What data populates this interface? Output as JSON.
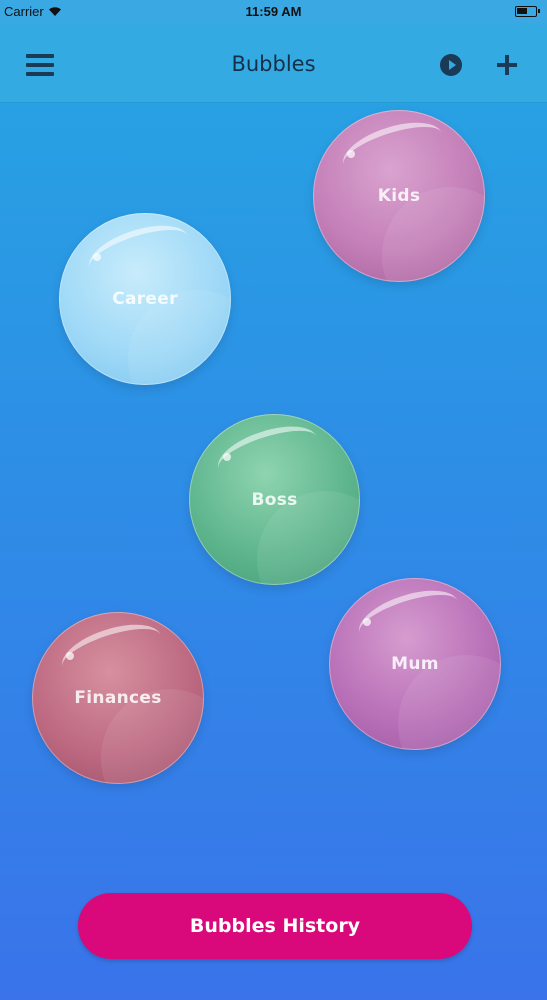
{
  "status_bar": {
    "carrier": "Carrier",
    "time": "11:59 AM",
    "wifi_icon": "wifi-icon",
    "battery_icon": "battery-icon"
  },
  "nav": {
    "title": "Bubbles",
    "menu_icon": "menu-icon",
    "play_icon": "play-icon",
    "add_icon": "plus-icon"
  },
  "bubbles": [
    {
      "label": "Kids",
      "color": "#c47fb8"
    },
    {
      "label": "Career",
      "color": "#9fd9f7"
    },
    {
      "label": "Boss",
      "color": "#5fb68e"
    },
    {
      "label": "Finances",
      "color": "#bd6a82"
    },
    {
      "label": "Mum",
      "color": "#b971b8"
    }
  ],
  "footer": {
    "history_button_label": "Bubbles History"
  },
  "colors": {
    "nav_background": "#33aae2",
    "background_top": "#26a6e2",
    "background_bottom": "#3a73ea",
    "accent_button": "#d9097b"
  }
}
